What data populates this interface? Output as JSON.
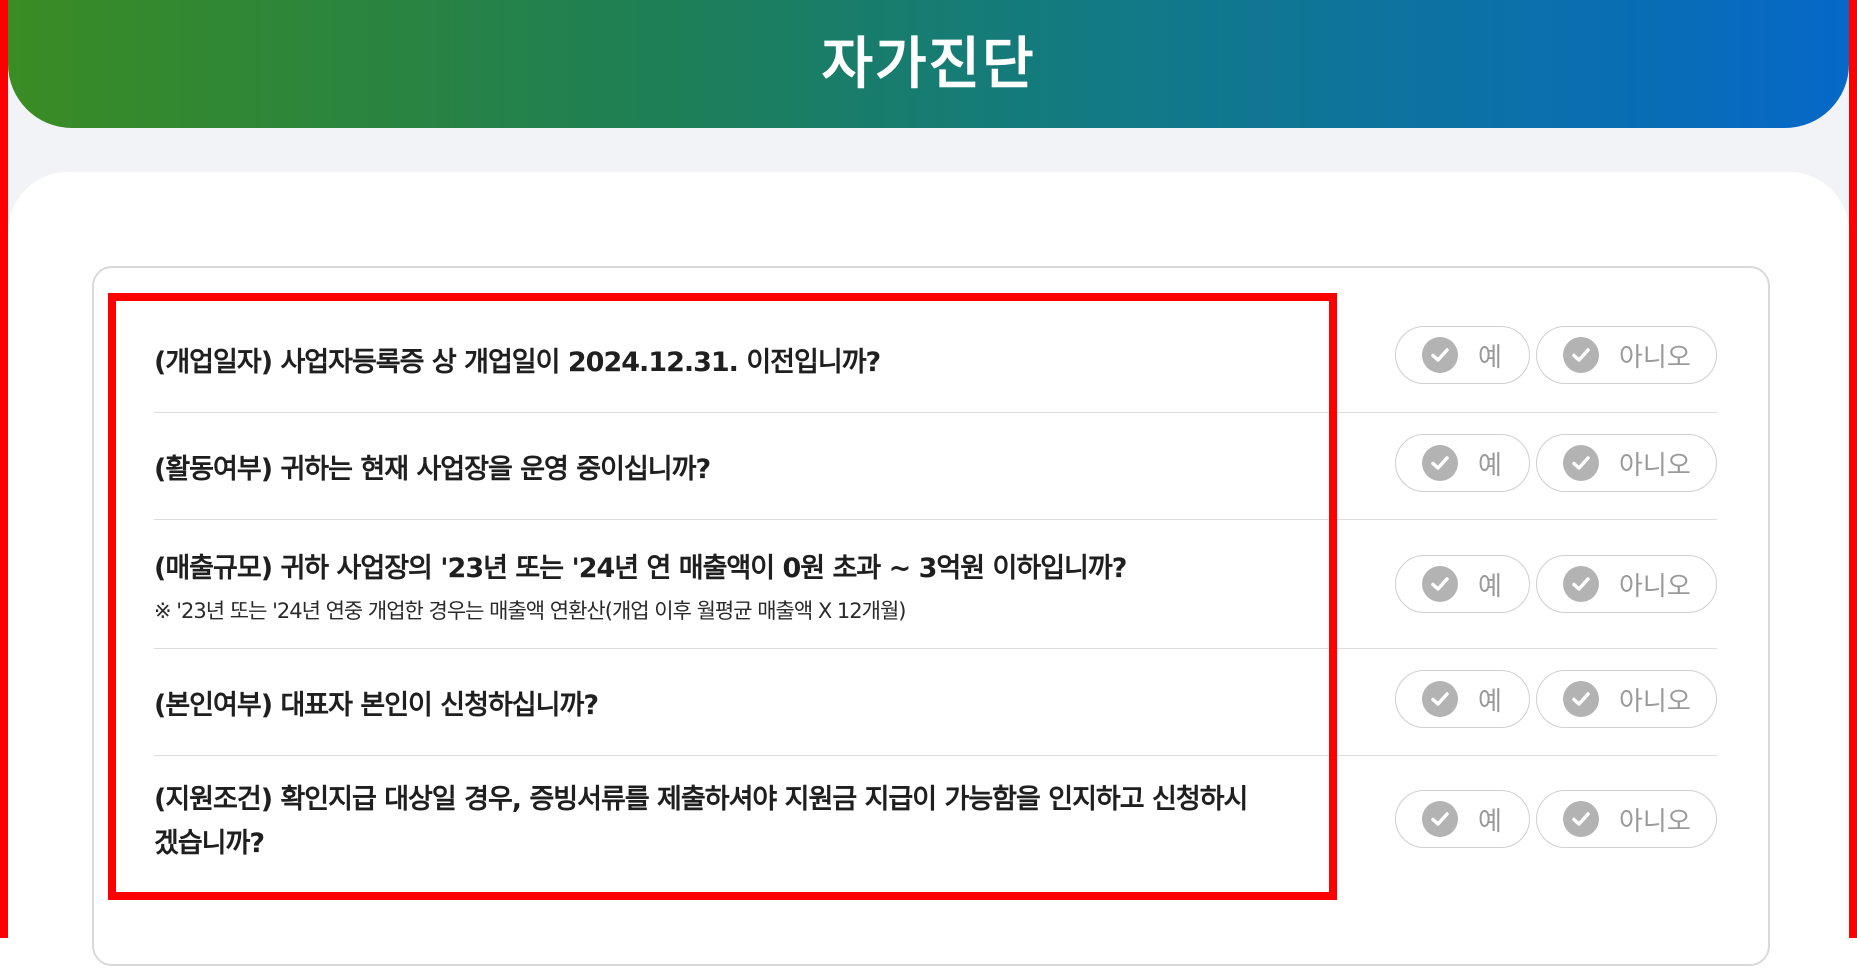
{
  "header": {
    "title": "자가진단"
  },
  "questions": [
    {
      "text": "(개업일자) 사업자등록증 상 개업일이 2024.12.31. 이전입니까?",
      "note": "",
      "yes_label": "예",
      "no_label": "아니오"
    },
    {
      "text": "(활동여부) 귀하는 현재 사업장을 운영 중이십니까?",
      "note": "",
      "yes_label": "예",
      "no_label": "아니오"
    },
    {
      "text": "(매출규모) 귀하 사업장의 '23년 또는 '24년 연 매출액이 0원 초과 ~ 3억원 이하입니까?",
      "note": "※ '23년 또는 '24년 연중 개업한 경우는 매출액 연환산(개업 이후 월평균 매출액 X 12개월)",
      "yes_label": "예",
      "no_label": "아니오"
    },
    {
      "text": "(본인여부) 대표자 본인이 신청하십니까?",
      "note": "",
      "yes_label": "예",
      "no_label": "아니오"
    },
    {
      "text": "(지원조건) 확인지급 대상일 경우, 증빙서류를 제출하셔야 지원금 지급이 가능함을 인지하고 신청하시겠습니까?",
      "note": "",
      "yes_label": "예",
      "no_label": "아니오"
    }
  ],
  "colors": {
    "banner_start": "#3a8c23",
    "banner_end": "#0668c8",
    "highlight": "#ff0000",
    "check_icon": "#b3b3b3"
  }
}
